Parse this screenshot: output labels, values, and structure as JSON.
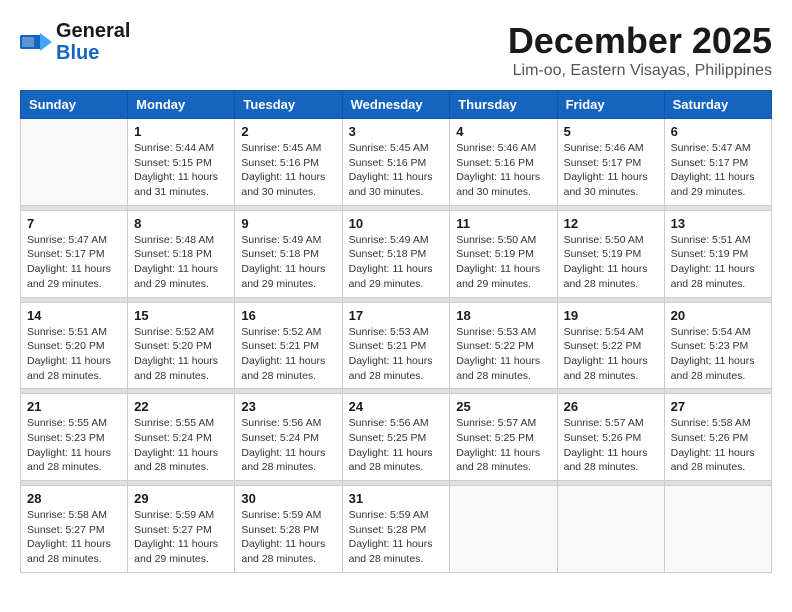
{
  "header": {
    "logo_general": "General",
    "logo_blue": "Blue",
    "month": "December 2025",
    "location": "Lim-oo, Eastern Visayas, Philippines"
  },
  "weekdays": [
    "Sunday",
    "Monday",
    "Tuesday",
    "Wednesday",
    "Thursday",
    "Friday",
    "Saturday"
  ],
  "weeks": [
    {
      "days": [
        {
          "num": "",
          "empty": true
        },
        {
          "num": "1",
          "sunrise": "5:44 AM",
          "sunset": "5:15 PM",
          "daylight": "11 hours and 31 minutes."
        },
        {
          "num": "2",
          "sunrise": "5:45 AM",
          "sunset": "5:16 PM",
          "daylight": "11 hours and 30 minutes."
        },
        {
          "num": "3",
          "sunrise": "5:45 AM",
          "sunset": "5:16 PM",
          "daylight": "11 hours and 30 minutes."
        },
        {
          "num": "4",
          "sunrise": "5:46 AM",
          "sunset": "5:16 PM",
          "daylight": "11 hours and 30 minutes."
        },
        {
          "num": "5",
          "sunrise": "5:46 AM",
          "sunset": "5:17 PM",
          "daylight": "11 hours and 30 minutes."
        },
        {
          "num": "6",
          "sunrise": "5:47 AM",
          "sunset": "5:17 PM",
          "daylight": "11 hours and 29 minutes."
        }
      ]
    },
    {
      "days": [
        {
          "num": "7",
          "sunrise": "5:47 AM",
          "sunset": "5:17 PM",
          "daylight": "11 hours and 29 minutes."
        },
        {
          "num": "8",
          "sunrise": "5:48 AM",
          "sunset": "5:18 PM",
          "daylight": "11 hours and 29 minutes."
        },
        {
          "num": "9",
          "sunrise": "5:49 AM",
          "sunset": "5:18 PM",
          "daylight": "11 hours and 29 minutes."
        },
        {
          "num": "10",
          "sunrise": "5:49 AM",
          "sunset": "5:18 PM",
          "daylight": "11 hours and 29 minutes."
        },
        {
          "num": "11",
          "sunrise": "5:50 AM",
          "sunset": "5:19 PM",
          "daylight": "11 hours and 29 minutes."
        },
        {
          "num": "12",
          "sunrise": "5:50 AM",
          "sunset": "5:19 PM",
          "daylight": "11 hours and 28 minutes."
        },
        {
          "num": "13",
          "sunrise": "5:51 AM",
          "sunset": "5:19 PM",
          "daylight": "11 hours and 28 minutes."
        }
      ]
    },
    {
      "days": [
        {
          "num": "14",
          "sunrise": "5:51 AM",
          "sunset": "5:20 PM",
          "daylight": "11 hours and 28 minutes."
        },
        {
          "num": "15",
          "sunrise": "5:52 AM",
          "sunset": "5:20 PM",
          "daylight": "11 hours and 28 minutes."
        },
        {
          "num": "16",
          "sunrise": "5:52 AM",
          "sunset": "5:21 PM",
          "daylight": "11 hours and 28 minutes."
        },
        {
          "num": "17",
          "sunrise": "5:53 AM",
          "sunset": "5:21 PM",
          "daylight": "11 hours and 28 minutes."
        },
        {
          "num": "18",
          "sunrise": "5:53 AM",
          "sunset": "5:22 PM",
          "daylight": "11 hours and 28 minutes."
        },
        {
          "num": "19",
          "sunrise": "5:54 AM",
          "sunset": "5:22 PM",
          "daylight": "11 hours and 28 minutes."
        },
        {
          "num": "20",
          "sunrise": "5:54 AM",
          "sunset": "5:23 PM",
          "daylight": "11 hours and 28 minutes."
        }
      ]
    },
    {
      "days": [
        {
          "num": "21",
          "sunrise": "5:55 AM",
          "sunset": "5:23 PM",
          "daylight": "11 hours and 28 minutes."
        },
        {
          "num": "22",
          "sunrise": "5:55 AM",
          "sunset": "5:24 PM",
          "daylight": "11 hours and 28 minutes."
        },
        {
          "num": "23",
          "sunrise": "5:56 AM",
          "sunset": "5:24 PM",
          "daylight": "11 hours and 28 minutes."
        },
        {
          "num": "24",
          "sunrise": "5:56 AM",
          "sunset": "5:25 PM",
          "daylight": "11 hours and 28 minutes."
        },
        {
          "num": "25",
          "sunrise": "5:57 AM",
          "sunset": "5:25 PM",
          "daylight": "11 hours and 28 minutes."
        },
        {
          "num": "26",
          "sunrise": "5:57 AM",
          "sunset": "5:26 PM",
          "daylight": "11 hours and 28 minutes."
        },
        {
          "num": "27",
          "sunrise": "5:58 AM",
          "sunset": "5:26 PM",
          "daylight": "11 hours and 28 minutes."
        }
      ]
    },
    {
      "days": [
        {
          "num": "28",
          "sunrise": "5:58 AM",
          "sunset": "5:27 PM",
          "daylight": "11 hours and 28 minutes."
        },
        {
          "num": "29",
          "sunrise": "5:59 AM",
          "sunset": "5:27 PM",
          "daylight": "11 hours and 29 minutes."
        },
        {
          "num": "30",
          "sunrise": "5:59 AM",
          "sunset": "5:28 PM",
          "daylight": "11 hours and 28 minutes."
        },
        {
          "num": "31",
          "sunrise": "5:59 AM",
          "sunset": "5:28 PM",
          "daylight": "11 hours and 28 minutes."
        },
        {
          "num": "",
          "empty": true
        },
        {
          "num": "",
          "empty": true
        },
        {
          "num": "",
          "empty": true
        }
      ]
    }
  ]
}
